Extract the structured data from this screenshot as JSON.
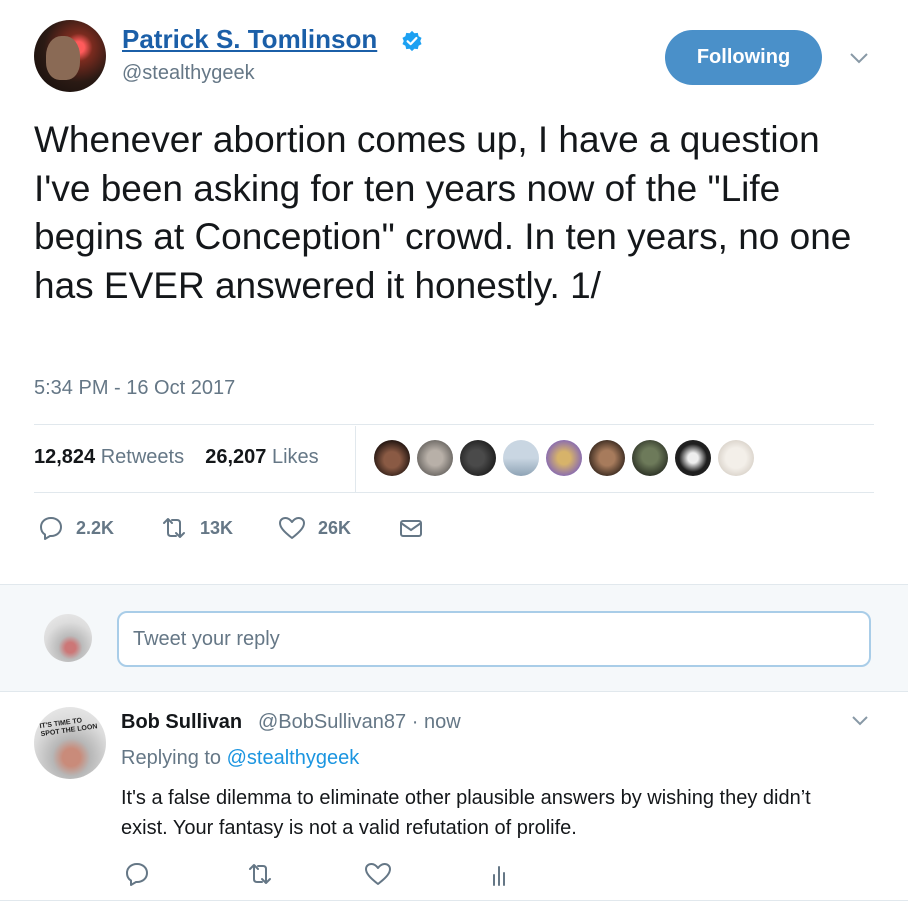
{
  "author": {
    "name": "Patrick S. Tomlinson",
    "handle": "@stealthygeek",
    "verified": true,
    "follow_label": "Following"
  },
  "tweet": {
    "text": "Whenever abortion comes up, I have a question I've been asking for ten years now of the \"Life begins at Conception\" crowd. In ten years, no one has EVER answered it honestly. 1/",
    "timestamp": "5:34 PM - 16 Oct 2017",
    "retweets_count": "12,824",
    "retweets_label": "Retweets",
    "likes_count": "26,207",
    "likes_label": "Likes",
    "actions": {
      "reply": "2.2K",
      "retweet": "13K",
      "like": "26K"
    }
  },
  "composer": {
    "placeholder": "Tweet your reply"
  },
  "reply": {
    "name": "Bob Sullivan",
    "handle": "@BobSullivan87",
    "time": "now",
    "replying_prefix": "Replying to",
    "replying_to": "@stealthygeek",
    "text": "It's a false dilemma to eliminate other plausible answers by wishing they didn’t exist. Your fantasy is not a valid refutation of prolife.",
    "avatar_text": "IT'S TIME TO SPOT THE LOON"
  },
  "colors": {
    "link_blue": "#1b95e0",
    "name_blue": "#1b5fa8",
    "follow_button": "#4a90c9",
    "muted": "#657786",
    "divider": "#e1e8ed"
  },
  "icons": [
    "verified-badge-icon",
    "chevron-down-icon",
    "reply-icon",
    "retweet-icon",
    "like-icon",
    "direct-message-icon",
    "analytics-icon"
  ]
}
